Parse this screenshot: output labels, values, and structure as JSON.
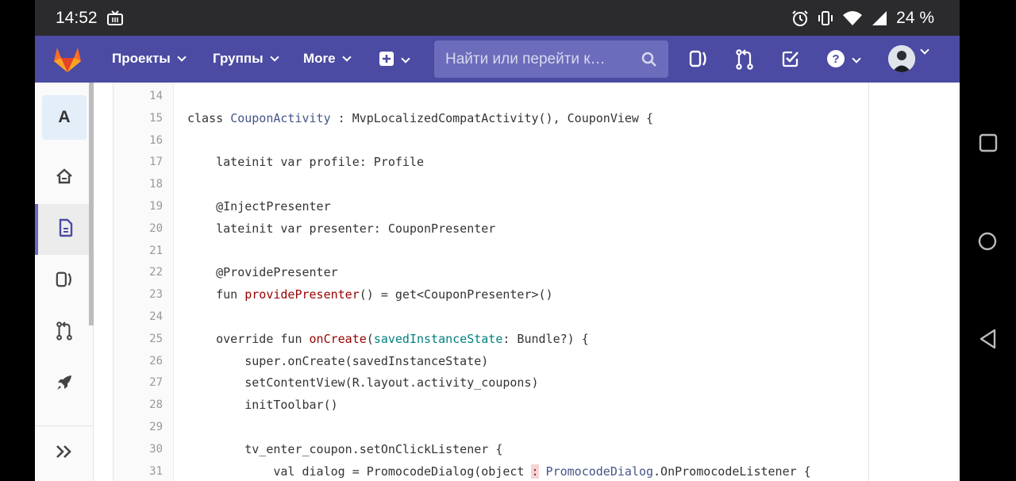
{
  "status_bar": {
    "time": "14:52",
    "battery": "24 %"
  },
  "header": {
    "nav": [
      {
        "label": "Проекты"
      },
      {
        "label": "Группы"
      },
      {
        "label": "More"
      }
    ],
    "search": {
      "placeholder": "Найти или перейти к…"
    },
    "brand_color": "#4b4ba3"
  },
  "sidebar": {
    "project_letter": "A",
    "items": [
      {
        "icon": "home-icon"
      },
      {
        "icon": "file-icon",
        "active": true
      },
      {
        "icon": "issues-icon"
      },
      {
        "icon": "merge-request-icon"
      },
      {
        "icon": "rocket-icon"
      }
    ],
    "collapse_icon": "double-chevron-right-icon"
  },
  "code": {
    "lines": [
      {
        "n": "14",
        "tokens": [
          {
            "t": ""
          }
        ]
      },
      {
        "n": "15",
        "tokens": [
          {
            "t": "class "
          },
          {
            "t": "CouponActivity",
            "c": "cls"
          },
          {
            "t": " : MvpLocalizedCompatActivity(), CouponView {"
          }
        ]
      },
      {
        "n": "16",
        "tokens": [
          {
            "t": ""
          }
        ]
      },
      {
        "n": "17",
        "tokens": [
          {
            "t": "    lateinit var profile: Profile"
          }
        ]
      },
      {
        "n": "18",
        "tokens": [
          {
            "t": ""
          }
        ]
      },
      {
        "n": "19",
        "tokens": [
          {
            "t": "    @InjectPresenter"
          }
        ]
      },
      {
        "n": "20",
        "tokens": [
          {
            "t": "    lateinit var presenter: CouponPresenter"
          }
        ]
      },
      {
        "n": "21",
        "tokens": [
          {
            "t": ""
          }
        ]
      },
      {
        "n": "22",
        "tokens": [
          {
            "t": "    @ProvidePresenter"
          }
        ]
      },
      {
        "n": "23",
        "tokens": [
          {
            "t": "    fun "
          },
          {
            "t": "providePresenter",
            "c": "fn"
          },
          {
            "t": "() = get<CouponPresenter>()"
          }
        ]
      },
      {
        "n": "24",
        "tokens": [
          {
            "t": ""
          }
        ]
      },
      {
        "n": "25",
        "tokens": [
          {
            "t": "    override fun "
          },
          {
            "t": "onCreate",
            "c": "fn"
          },
          {
            "t": "("
          },
          {
            "t": "savedInstanceState",
            "c": "param"
          },
          {
            "t": ": Bundle?) {"
          }
        ]
      },
      {
        "n": "26",
        "tokens": [
          {
            "t": "        super.onCreate(savedInstanceState)"
          }
        ]
      },
      {
        "n": "27",
        "tokens": [
          {
            "t": "        setContentView(R.layout.activity_coupons)"
          }
        ]
      },
      {
        "n": "28",
        "tokens": [
          {
            "t": "        initToolbar()"
          }
        ]
      },
      {
        "n": "29",
        "tokens": [
          {
            "t": ""
          }
        ]
      },
      {
        "n": "30",
        "tokens": [
          {
            "t": "        tv_enter_coupon.setOnClickListener {"
          }
        ]
      },
      {
        "n": "31",
        "tokens": [
          {
            "t": "            val dialog = PromocodeDialog(object "
          },
          {
            "t": ":",
            "c": "err"
          },
          {
            "t": " "
          },
          {
            "t": "PromocodeDialog",
            "c": "cls"
          },
          {
            "t": ".OnPromocodeListener {"
          }
        ]
      }
    ]
  }
}
